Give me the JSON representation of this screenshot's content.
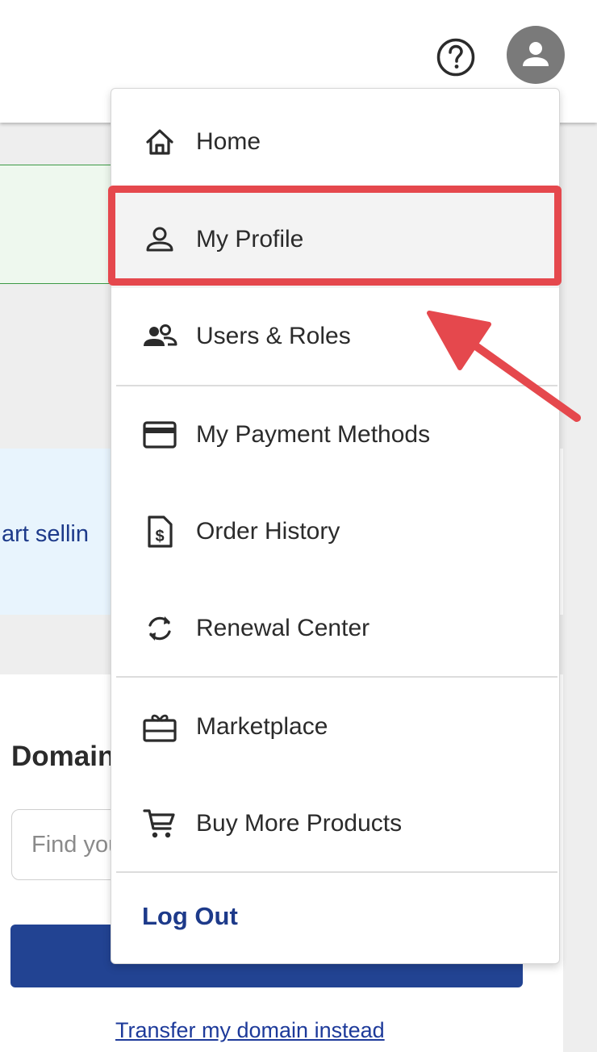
{
  "header": {
    "help_icon": "help-circle-icon",
    "avatar_icon": "user-avatar-icon"
  },
  "background": {
    "partial_text": "art sellin",
    "card_title": "Domain",
    "search_placeholder": "Find your",
    "transfer_link": "Transfer my domain instead"
  },
  "menu": {
    "items": [
      {
        "label": "Home",
        "icon": "home-icon"
      },
      {
        "label": "My Profile",
        "icon": "person-icon"
      },
      {
        "label": "Users & Roles",
        "icon": "users-icon"
      },
      {
        "label": "My Payment Methods",
        "icon": "credit-card-icon"
      },
      {
        "label": "Order History",
        "icon": "receipt-dollar-icon"
      },
      {
        "label": "Renewal Center",
        "icon": "renew-icon"
      },
      {
        "label": "Marketplace",
        "icon": "gift-card-icon"
      },
      {
        "label": "Buy More Products",
        "icon": "cart-icon"
      }
    ],
    "logout_label": "Log Out"
  },
  "annotation": {
    "highlight_color": "#e5484d",
    "highlighted_item": "My Profile"
  }
}
